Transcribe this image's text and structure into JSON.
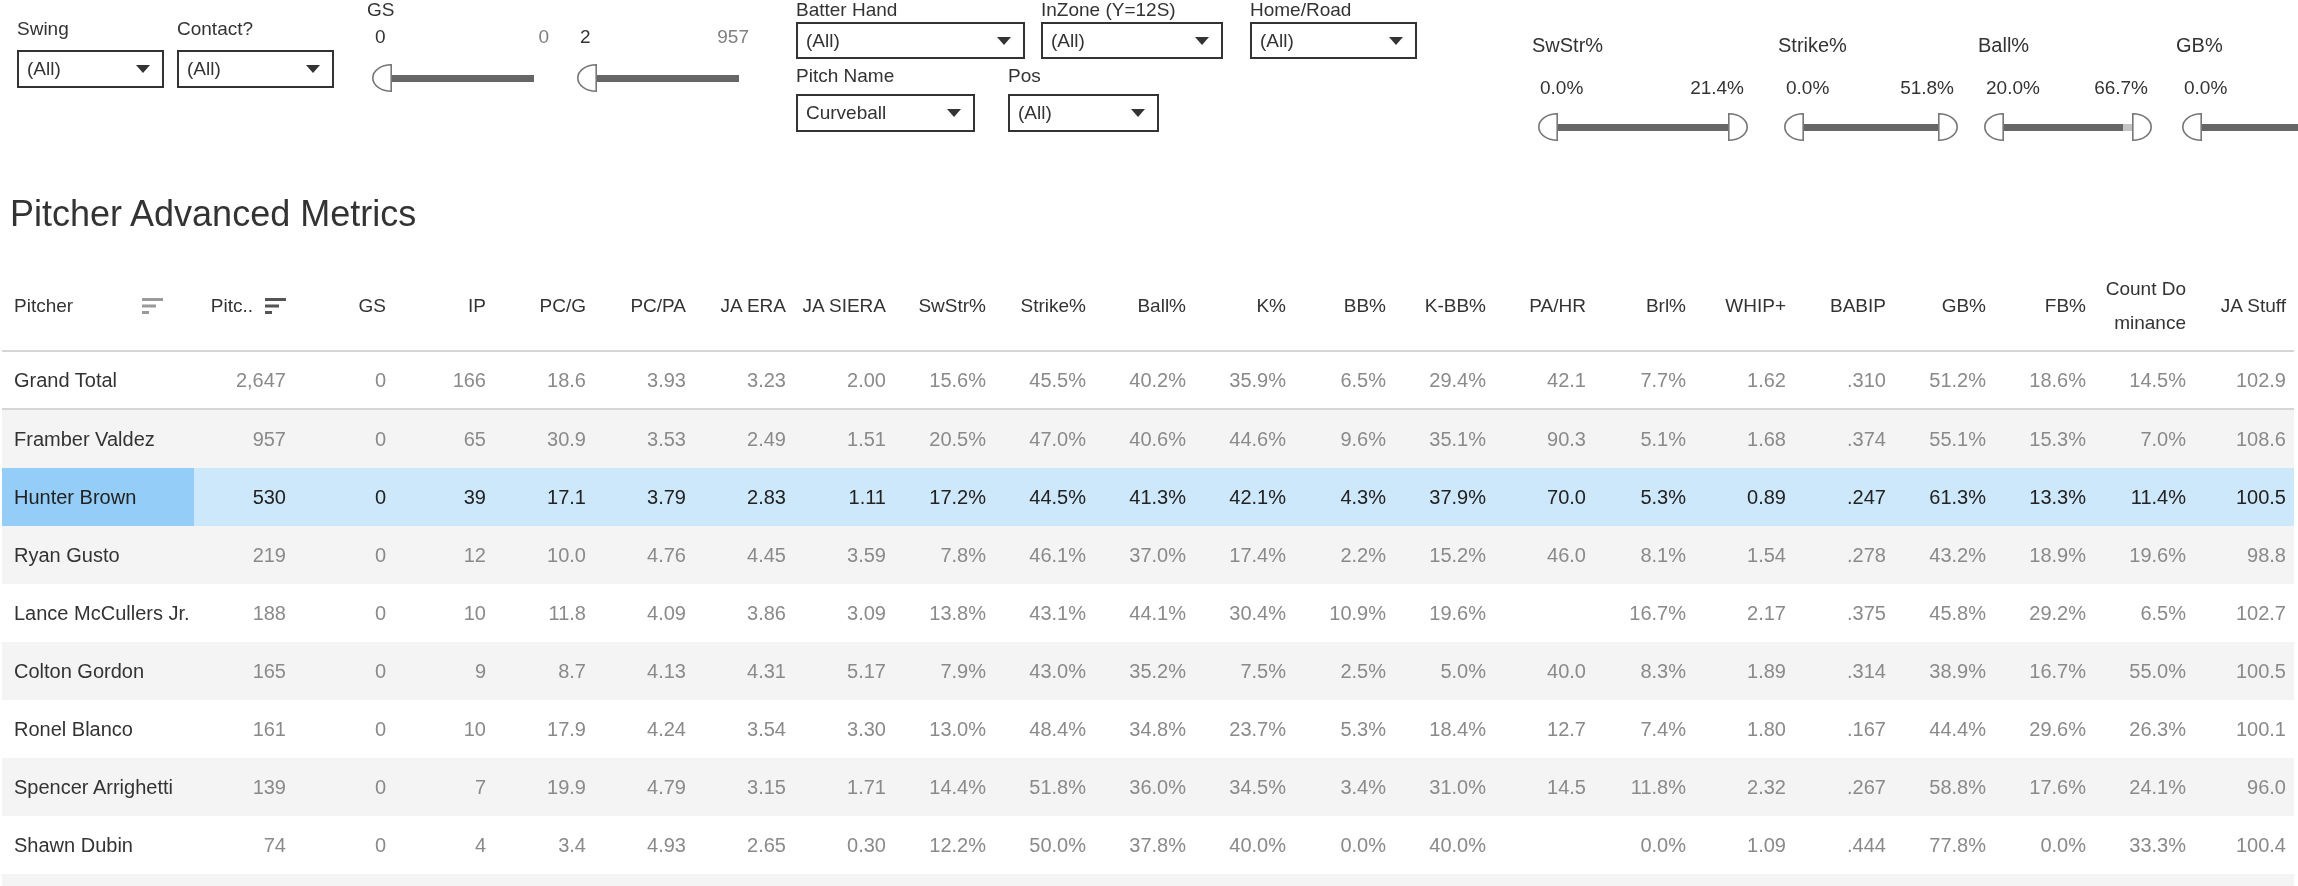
{
  "filters": {
    "dropdowns": [
      {
        "label": "Swing",
        "value": "(All)"
      },
      {
        "label": "Contact?",
        "value": "(All)"
      }
    ],
    "count_sliders": [
      {
        "label": "GS",
        "min": "0",
        "max": "0",
        "level": 1
      },
      {
        "min": "2",
        "max": "957",
        "level": 1
      }
    ],
    "dropdown_rows": [
      {
        "dropdowns": [
          {
            "label": "Batter Hand",
            "value": "(All)"
          },
          {
            "label": "InZone (Y=12S)",
            "value": "(All)"
          },
          {
            "label": "Home/Road",
            "value": "(All)"
          }
        ]
      },
      {
        "dropdowns": [
          {
            "label": "Pitch Name",
            "value": "Curveball"
          },
          {
            "label": "Pos",
            "value": "(All)"
          }
        ]
      }
    ],
    "range_sliders": [
      {
        "label": "SwStr%",
        "min": "0.0%",
        "max": "21.4%",
        "level": 1
      },
      {
        "label": "Strike%",
        "min": "0.0%",
        "max": "51.8%",
        "level": 1
      },
      {
        "label": "Ball%",
        "min": "20.0%",
        "max": "66.7%",
        "level": 0.93
      },
      {
        "label": "GB%",
        "min": "0.0%",
        "level": 1
      }
    ]
  },
  "title": "Pitcher Advanced Metrics",
  "table": {
    "columns": [
      {
        "label": "Pitcher",
        "sort_icon": true,
        "sorted": false
      },
      {
        "label": "Pitc..",
        "sort_icon": true,
        "sorted": true
      },
      {
        "label": "GS",
        "sort_icon": false,
        "sorted": false
      },
      {
        "label": "IP",
        "sort_icon": false,
        "sorted": false
      },
      {
        "label": "PC/G",
        "sort_icon": false,
        "sorted": false
      },
      {
        "label": "PC/PA",
        "sort_icon": false,
        "sorted": false
      },
      {
        "label": "JA ERA",
        "sort_icon": false,
        "sorted": false
      },
      {
        "label": "JA SIERA",
        "sort_icon": false,
        "sorted": false
      },
      {
        "label": "SwStr%",
        "sort_icon": false,
        "sorted": false
      },
      {
        "label": "Strike%",
        "sort_icon": false,
        "sorted": false
      },
      {
        "label": "Ball%",
        "sort_icon": false,
        "sorted": false
      },
      {
        "label": "K%",
        "sort_icon": false,
        "sorted": false
      },
      {
        "label": "BB%",
        "sort_icon": false,
        "sorted": false
      },
      {
        "label": "K-BB%",
        "sort_icon": false,
        "sorted": false
      },
      {
        "label": "PA/HR",
        "sort_icon": false,
        "sorted": false
      },
      {
        "label": "Brl%",
        "sort_icon": false,
        "sorted": false
      },
      {
        "label": "WHIP+",
        "sort_icon": false,
        "sorted": false
      },
      {
        "label": "BABIP",
        "sort_icon": false,
        "sorted": false
      },
      {
        "label": "GB%",
        "sort_icon": false,
        "sorted": false
      },
      {
        "label": "FB%",
        "sort_icon": false,
        "sorted": false
      },
      {
        "label": "Count Dominance",
        "sort_icon": false,
        "sorted": false
      },
      {
        "label": "JA Stuff",
        "sort_icon": false,
        "sorted": false
      }
    ],
    "rows": [
      {
        "kind": "total",
        "selected": false,
        "cells": [
          "Grand Total",
          "2,647",
          "0",
          "166",
          "18.6",
          "3.93",
          "3.23",
          "2.00",
          "15.6%",
          "45.5%",
          "40.2%",
          "35.9%",
          "6.5%",
          "29.4%",
          "42.1",
          "7.7%",
          "1.62",
          ".310",
          "51.2%",
          "18.6%",
          "14.5%",
          "102.9"
        ]
      },
      {
        "kind": "pitcher",
        "selected": false,
        "cells": [
          "Framber Valdez",
          "957",
          "0",
          "65",
          "30.9",
          "3.53",
          "2.49",
          "1.51",
          "20.5%",
          "47.0%",
          "40.6%",
          "44.6%",
          "9.6%",
          "35.1%",
          "90.3",
          "5.1%",
          "1.68",
          ".374",
          "55.1%",
          "15.3%",
          "7.0%",
          "108.6"
        ]
      },
      {
        "kind": "pitcher",
        "selected": true,
        "cells": [
          "Hunter Brown",
          "530",
          "0",
          "39",
          "17.1",
          "3.79",
          "2.83",
          "1.11",
          "17.2%",
          "44.5%",
          "41.3%",
          "42.1%",
          "4.3%",
          "37.9%",
          "70.0",
          "5.3%",
          "0.89",
          ".247",
          "61.3%",
          "13.3%",
          "11.4%",
          "100.5"
        ]
      },
      {
        "kind": "pitcher",
        "selected": false,
        "cells": [
          "Ryan Gusto",
          "219",
          "0",
          "12",
          "10.0",
          "4.76",
          "4.45",
          "3.59",
          "7.8%",
          "46.1%",
          "37.0%",
          "17.4%",
          "2.2%",
          "15.2%",
          "46.0",
          "8.1%",
          "1.54",
          ".278",
          "43.2%",
          "18.9%",
          "19.6%",
          "98.8"
        ]
      },
      {
        "kind": "pitcher",
        "selected": false,
        "cells": [
          "Lance McCullers Jr.",
          "188",
          "0",
          "10",
          "11.8",
          "4.09",
          "3.86",
          "3.09",
          "13.8%",
          "43.1%",
          "44.1%",
          "30.4%",
          "10.9%",
          "19.6%",
          "",
          "16.7%",
          "2.17",
          ".375",
          "45.8%",
          "29.2%",
          "6.5%",
          "102.7"
        ]
      },
      {
        "kind": "pitcher",
        "selected": false,
        "cells": [
          "Colton Gordon",
          "165",
          "0",
          "9",
          "8.7",
          "4.13",
          "4.31",
          "5.17",
          "7.9%",
          "43.0%",
          "35.2%",
          "7.5%",
          "2.5%",
          "5.0%",
          "40.0",
          "8.3%",
          "1.89",
          ".314",
          "38.9%",
          "16.7%",
          "55.0%",
          "100.5"
        ]
      },
      {
        "kind": "pitcher",
        "selected": false,
        "cells": [
          "Ronel Blanco",
          "161",
          "0",
          "10",
          "17.9",
          "4.24",
          "3.54",
          "3.30",
          "13.0%",
          "48.4%",
          "34.8%",
          "23.7%",
          "5.3%",
          "18.4%",
          "12.7",
          "7.4%",
          "1.80",
          ".167",
          "44.4%",
          "29.6%",
          "26.3%",
          "100.1"
        ]
      },
      {
        "kind": "pitcher",
        "selected": false,
        "cells": [
          "Spencer Arrighetti",
          "139",
          "0",
          "7",
          "19.9",
          "4.79",
          "3.15",
          "1.71",
          "14.4%",
          "51.8%",
          "36.0%",
          "34.5%",
          "3.4%",
          "31.0%",
          "14.5",
          "11.8%",
          "2.32",
          ".267",
          "58.8%",
          "17.6%",
          "24.1%",
          "96.0"
        ]
      },
      {
        "kind": "pitcher",
        "selected": false,
        "cells": [
          "Shawn Dubin",
          "74",
          "0",
          "4",
          "3.4",
          "4.93",
          "2.65",
          "0.30",
          "12.2%",
          "50.0%",
          "37.8%",
          "40.0%",
          "0.0%",
          "40.0%",
          "",
          "0.0%",
          "1.09",
          ".444",
          "77.8%",
          "0.0%",
          "33.3%",
          "100.4"
        ]
      }
    ]
  }
}
